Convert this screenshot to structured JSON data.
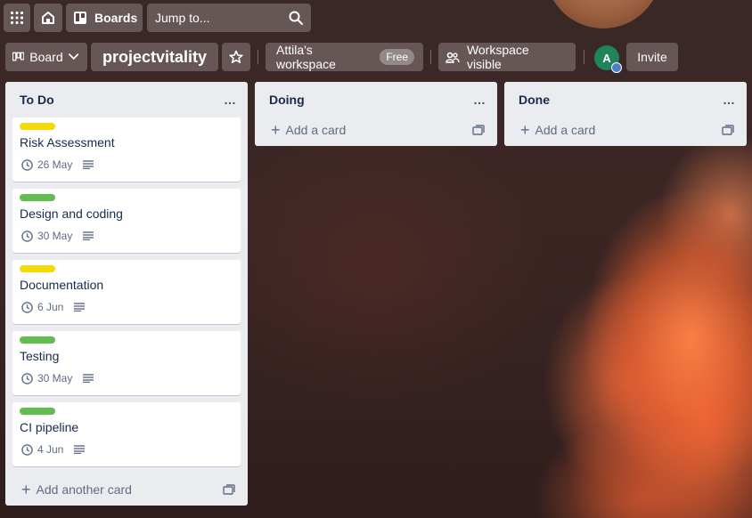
{
  "topbar": {
    "boards_label": "Boards",
    "search_placeholder": "Jump to..."
  },
  "board_header": {
    "view_label": "Board",
    "title": "projectvitality",
    "workspace_label": "Attila's workspace",
    "workspace_badge": "Free",
    "visibility_label": "Workspace visible",
    "avatar_initial": "A",
    "invite_label": "Invite"
  },
  "lists": [
    {
      "title": "To Do",
      "menu": "…",
      "add_label": "Add another card",
      "cards": [
        {
          "title": "Risk Assessment",
          "label_color": "#f5d90a",
          "date": "26 May"
        },
        {
          "title": "Design and coding",
          "label_color": "#61bd4f",
          "date": "30 May"
        },
        {
          "title": "Documentation",
          "label_color": "#f5d90a",
          "date": "6 Jun"
        },
        {
          "title": "Testing",
          "label_color": "#61bd4f",
          "date": "30 May"
        },
        {
          "title": "CI pipeline",
          "label_color": "#61bd4f",
          "date": "4 Jun"
        }
      ]
    },
    {
      "title": "Doing",
      "menu": "…",
      "add_label": "Add a card",
      "cards": []
    },
    {
      "title": "Done",
      "menu": "…",
      "add_label": "Add a card",
      "cards": []
    }
  ],
  "colors": {
    "label_yellow": "#f5d90a",
    "label_green": "#61bd4f",
    "avatar": "#1f845a"
  },
  "icons": [
    "apps-grid-icon",
    "home-icon",
    "boards-icon",
    "search-icon",
    "board-view-icon",
    "chevron-down-icon",
    "star-icon",
    "visibility-icon",
    "clock-icon",
    "description-icon",
    "plus-icon",
    "card-template-icon"
  ]
}
